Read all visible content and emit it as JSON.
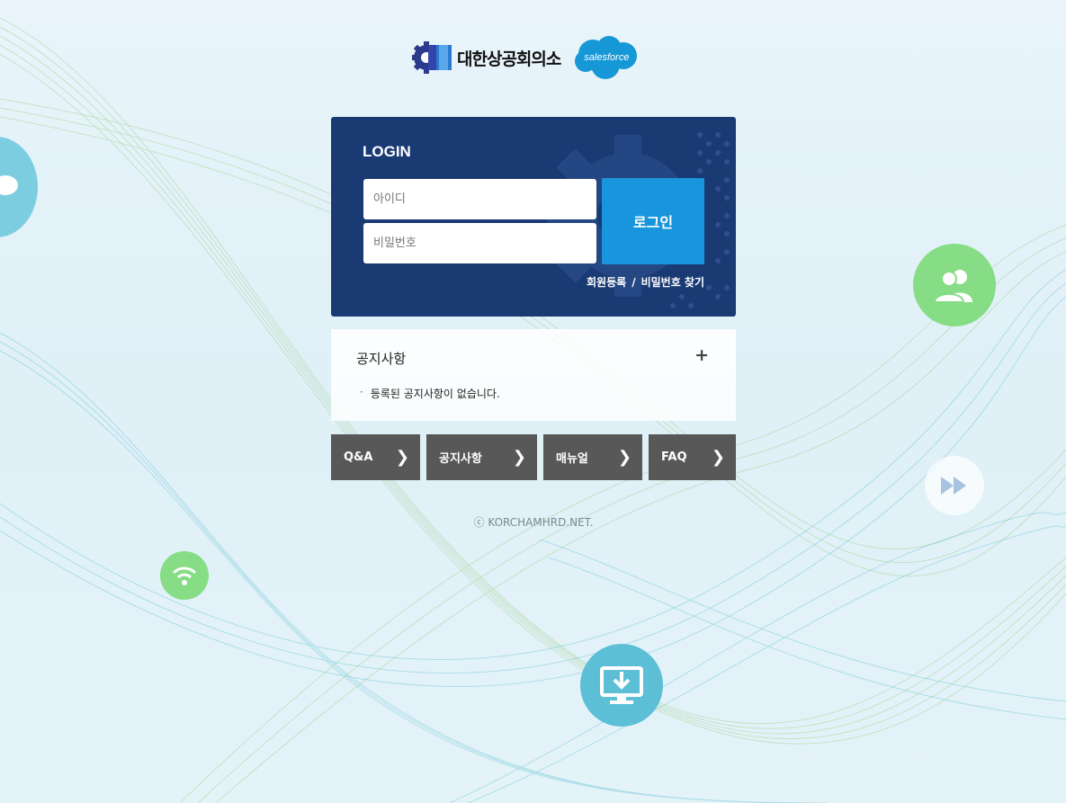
{
  "header": {
    "kcci_name": "대한상공회의소",
    "partner_name": "salesforce"
  },
  "login": {
    "title": "LOGIN",
    "id_placeholder": "아이디",
    "pw_placeholder": "비밀번호",
    "button_label": "로그인",
    "register_label": "회원등록",
    "separator": "/",
    "find_pw_label": "비밀번호 찾기"
  },
  "notice": {
    "title": "공지사항",
    "more_symbol": "+",
    "bullet": "·",
    "empty_message": "등록된 공지사항이 없습니다."
  },
  "quick_links": [
    {
      "label": "Q&A",
      "icon": "chevron-right-icon"
    },
    {
      "label": "공지사항",
      "icon": "chevron-right-icon"
    },
    {
      "label": "매뉴얼",
      "icon": "chevron-right-icon"
    },
    {
      "label": "FAQ",
      "icon": "chevron-right-icon"
    }
  ],
  "footer": {
    "copyright": "ⓒ KORCHAMHRD.NET."
  },
  "colors": {
    "login_bg": "#1a3a73",
    "login_button": "#1895dc",
    "quick_link_bg": "#585858",
    "icon_green": "#7dd87d",
    "icon_blue": "#5bc0d6"
  }
}
